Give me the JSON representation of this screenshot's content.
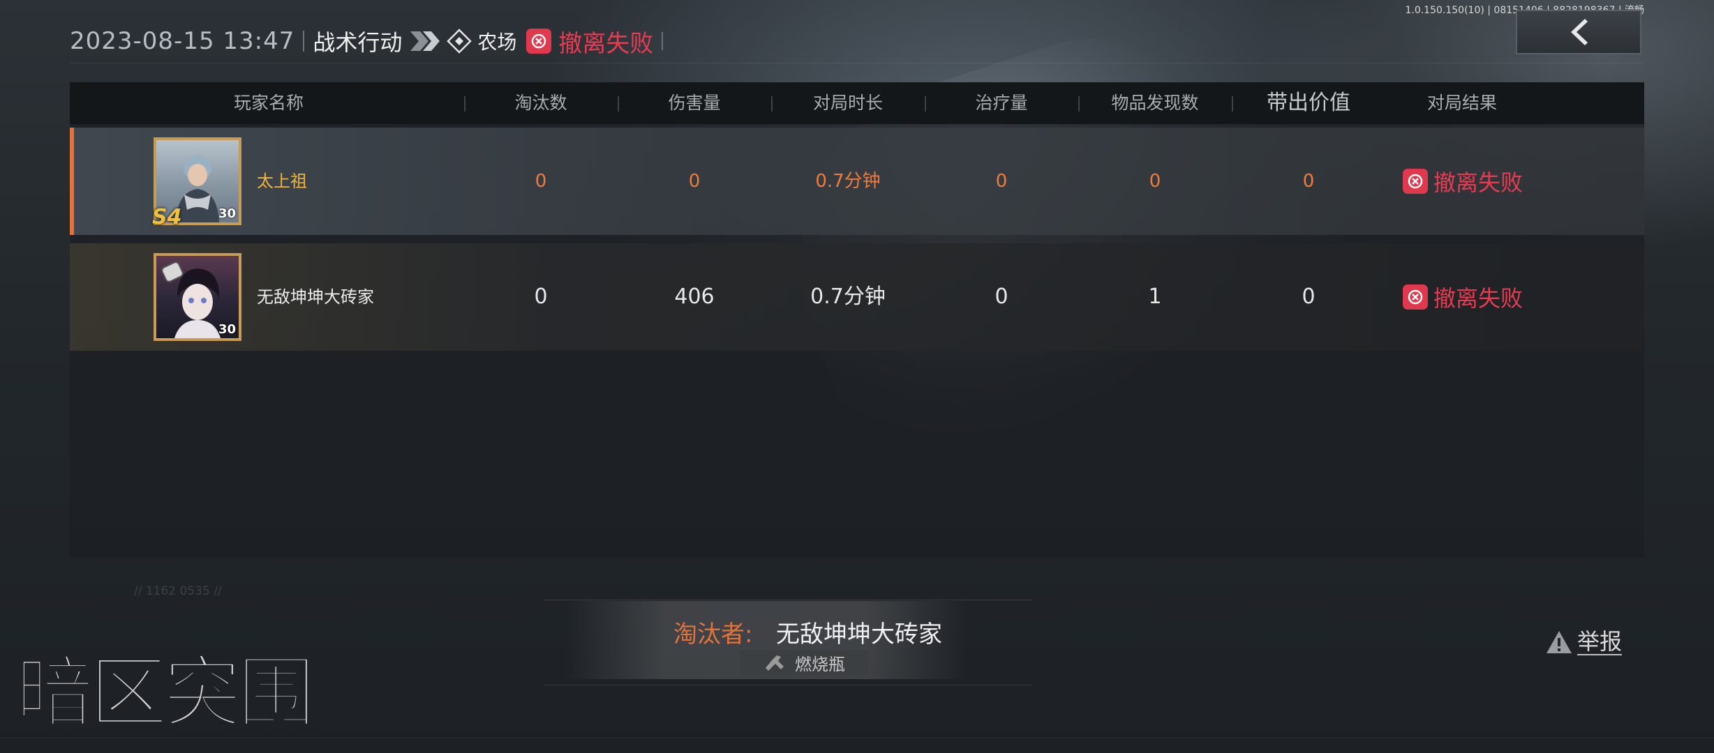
{
  "header": {
    "datetime": "2023-08-15 13:47",
    "mode": "战术行动",
    "map": "农场",
    "status": "撤离失败"
  },
  "debug_info": "1.0.150.150(10) | 08151406 | 8828198367 | 流畅",
  "table": {
    "columns": [
      "玩家名称",
      "淘汰数",
      "伤害量",
      "对局时长",
      "治疗量",
      "物品发现数",
      "带出价值",
      "对局结果"
    ],
    "rows": [
      {
        "player": "太上祖",
        "level": "30",
        "season_badge": "S4",
        "kills": "0",
        "damage": "0",
        "duration": "0.7分钟",
        "healing": "0",
        "items_found": "0",
        "extracted_value": "0",
        "result": "撤离失败"
      },
      {
        "player": "无敌坤坤大砖家",
        "level": "30",
        "kills": "0",
        "damage": "406",
        "duration": "0.7分钟",
        "healing": "0",
        "items_found": "1",
        "extracted_value": "0",
        "result": "撤离失败"
      }
    ]
  },
  "killer": {
    "label": "淘汰者:",
    "name": "无敌坤坤大砖家",
    "weapon": "燃烧瓶"
  },
  "report_label": "举报",
  "logo_text": "暗区突围",
  "faint_text": "// 1162 0535 //",
  "colors": {
    "accent_orange": "#e2733a",
    "fail_red": "#e63c52",
    "gold_name": "#f0b43a"
  }
}
